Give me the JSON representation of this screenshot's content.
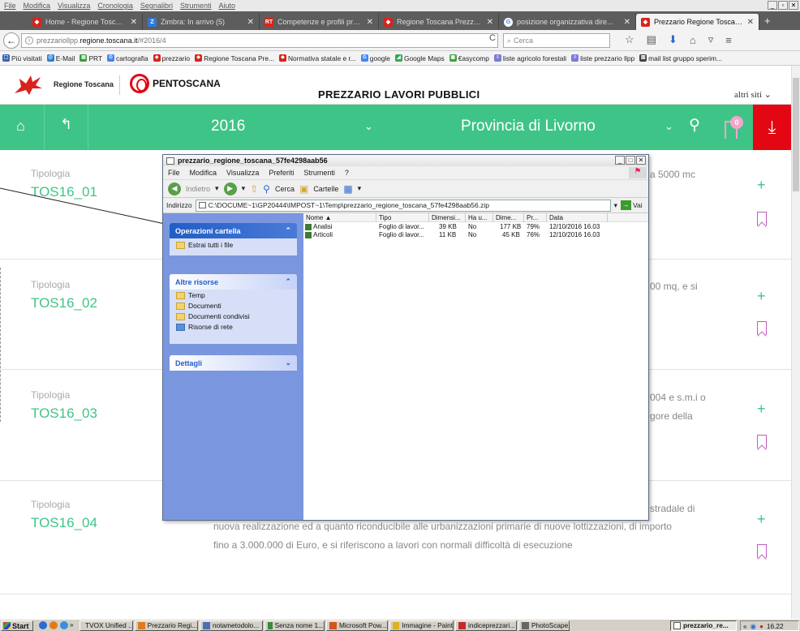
{
  "browser": {
    "menu": [
      "File",
      "Modifica",
      "Visualizza",
      "Cronologia",
      "Segnalibri",
      "Strumenti",
      "Aiuto"
    ],
    "tabs": [
      {
        "title": "Home - Regione Toscana",
        "icon_color": "#d9221c",
        "active": false
      },
      {
        "title": "Zimbra: In arrivo (5)",
        "icon_color": "#2e7bd6",
        "active": false
      },
      {
        "title": "Competenze e profili profes...",
        "icon_color": "#d9221c",
        "active": false
      },
      {
        "title": "Regione Toscana Prezzario",
        "icon_color": "#d9221c",
        "active": false
      },
      {
        "title": "posizione organizzativa dire...",
        "icon_color": "#4285f4",
        "active": false
      },
      {
        "title": "Prezzario Regione Toscana",
        "icon_color": "#d9221c",
        "active": true
      }
    ],
    "url_prefix": "prezzariollpp.",
    "url_domain": "regione.toscana.it",
    "url_suffix": "/#2016/4",
    "search_placeholder": "Cerca",
    "bookmarks": [
      {
        "label": "Più visitati",
        "color": "#3a63b8"
      },
      {
        "label": "E-Mail",
        "color": "#2c7fd4"
      },
      {
        "label": "PRT",
        "color": "#3a9a3a"
      },
      {
        "label": "cartografia",
        "color": "#4285f4"
      },
      {
        "label": "prezzario",
        "color": "#d9221c"
      },
      {
        "label": "Regione Toscana Pre...",
        "color": "#d9221c"
      },
      {
        "label": "Normativa statale e r...",
        "color": "#d9221c"
      },
      {
        "label": "google",
        "color": "#4285f4"
      },
      {
        "label": "Google Maps",
        "color": "#34a853"
      },
      {
        "label": "€asycomp",
        "color": "#3aa53a"
      },
      {
        "label": "liste agricolo forestali",
        "color": "#7b7bd6"
      },
      {
        "label": "liste prezzario llpp",
        "color": "#7b7bd6"
      },
      {
        "label": "mail list gruppo sperim...",
        "color": "#444444"
      }
    ]
  },
  "site": {
    "org_name": "Regione Toscana",
    "brand": "PENTOSCANA",
    "heading": "PREZZARIO LAVORI PUBBLICI",
    "other_sites": "altri siti",
    "year": "2016",
    "province": "Provincia di Livorno",
    "saved_count": "0",
    "accent": "#3fc488",
    "danger": "#e30613",
    "cards": [
      {
        "label": "Tipologia",
        "code": "TOS16_01",
        "text": "a 5000 mc"
      },
      {
        "label": "Tipologia",
        "code": "TOS16_02",
        "text": "00 mq, e si"
      },
      {
        "label": "Tipologia",
        "code": "TOS16_03",
        "text1": "004 e s.m.i o",
        "text2": "gore della"
      },
      {
        "label": "Tipologia",
        "code": "TOS16_04",
        "text0": "stradale di",
        "text1": "nuova realizzazione ed a quanto riconducibile alle urbanizzazioni primarie di nuove lottizzazioni, di importo",
        "text2": "fino a 3.000.000 di Euro, e si riferiscono a lavori con normali difficoltà di esecuzione"
      }
    ]
  },
  "explorer": {
    "title": "prezzario_regione_toscana_57fe4298aab56",
    "menu": [
      "File",
      "Modifica",
      "Visualizza",
      "Preferiti",
      "Strumenti",
      "?"
    ],
    "back": "Indietro",
    "search": "Cerca",
    "folders": "Cartelle",
    "address_label": "Indirizzo",
    "address": "C:\\DOCUME~1\\GP20444\\IMPOST~1\\Temp\\prezzario_regione_toscana_57fe4298aab56.zip",
    "go": "Vai",
    "task_folder_title": "Operazioni cartella",
    "task_extract": "Estrai tutti i file",
    "other_title": "Altre risorse",
    "other_items": [
      "Temp",
      "Documenti",
      "Documenti condivisi",
      "Risorse di rete"
    ],
    "details_title": "Dettagli",
    "columns": [
      "Nome ▲",
      "Tipo",
      "Dimensi...",
      "Ha u...",
      "Dime...",
      "Pr...",
      "Data"
    ],
    "files": [
      {
        "name": "Analisi",
        "type": "Foglio di lavor...",
        "size": "39 KB",
        "pw": "No",
        "full": "177 KB",
        "ratio": "79%",
        "date": "12/10/2016 16.03"
      },
      {
        "name": "Articoli",
        "type": "Foglio di lavor...",
        "size": "11 KB",
        "pw": "No",
        "full": "45 KB",
        "ratio": "76%",
        "date": "12/10/2016 16.03"
      }
    ]
  },
  "taskbar": {
    "start": "Start",
    "buttons": [
      "TVOX Unified ...",
      "Prezzario Regi...",
      "notametodolo...",
      "Senza nome 1...",
      "Microsoft Pow...",
      "Immagine - Paint",
      "indiceprezzari...",
      "PhotoScape",
      "prezzario_re..."
    ],
    "clock": "16.22"
  }
}
